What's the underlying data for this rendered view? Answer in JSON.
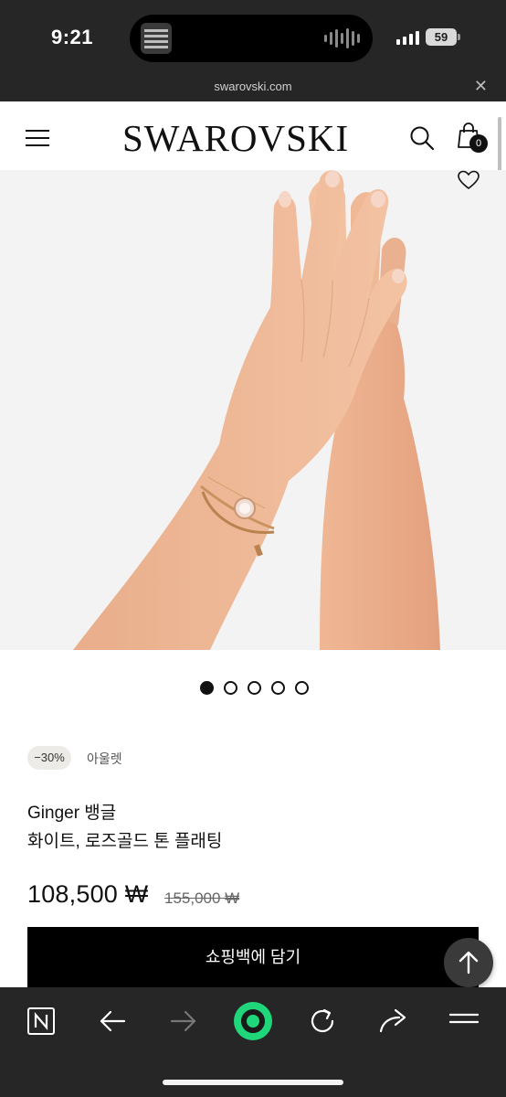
{
  "status_bar": {
    "time": "9:21",
    "battery": "59",
    "icons": [
      "now-playing-artwork",
      "audio-waveform-icon",
      "cellular-signal-icon",
      "battery-icon"
    ]
  },
  "browser": {
    "url": "swarovski.com",
    "close_icon": "close-icon",
    "toolbar_icons": [
      "naver-n-icon",
      "back-arrow-icon",
      "forward-arrow-icon",
      "green-voice-icon",
      "reload-icon",
      "share-icon",
      "hamburger-menu-icon"
    ]
  },
  "header": {
    "logo": "SWAROVSKI",
    "bag_count": "0",
    "icons": [
      "hamburger-menu-icon",
      "search-icon",
      "shopping-bag-icon"
    ]
  },
  "gallery": {
    "slide_count": 5,
    "active_slide": 1,
    "icons": [
      "heart-icon"
    ]
  },
  "product": {
    "discount_badge": "−30%",
    "outlet_label": "아울렛",
    "name": "Ginger 뱅글",
    "variant": "화이트, 로즈골드 톤 플래팅",
    "price": "108,500 ₩",
    "original_price": "155,000 ₩"
  },
  "cta": {
    "add_to_bag": "쇼핑백에 담기",
    "scroll_top_icon": "arrow-up-icon"
  },
  "colors": {
    "browser_chrome": "#262626",
    "accent_green": "#1fd67a",
    "button_black": "#000000",
    "badge_bg": "#ecebe7"
  }
}
